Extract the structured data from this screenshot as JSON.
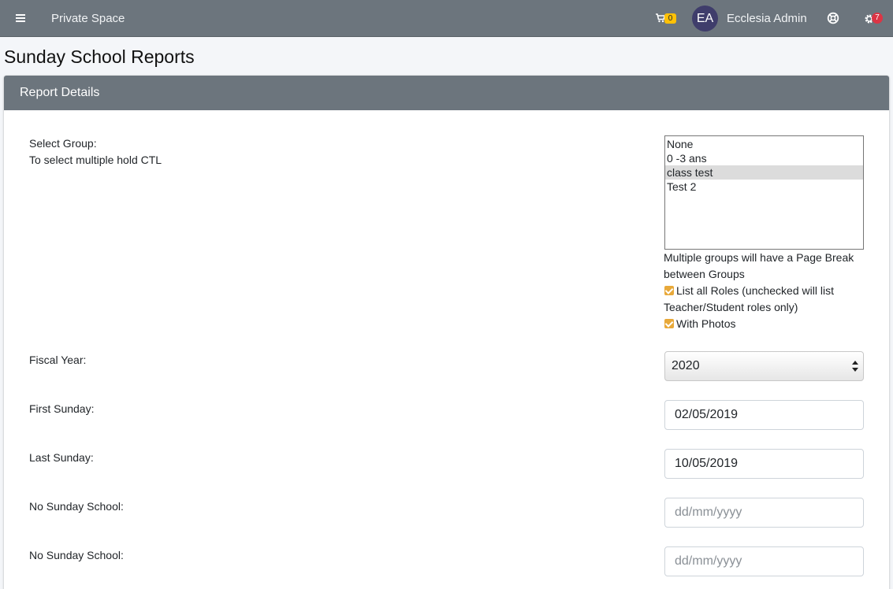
{
  "navbar": {
    "brand": "Private Space",
    "cart_count": "0",
    "avatar_initials": "EA",
    "user_name": "Ecclesia Admin",
    "notifications_count": "7",
    "colors": {
      "bar": "#6c757d",
      "cart_badge": "#ffc107",
      "notify_badge": "#dc3545",
      "avatar": "#3f3d6b"
    }
  },
  "page": {
    "title": "Sunday School Reports"
  },
  "card": {
    "title": "Report Details",
    "select_group": {
      "label_line1": "Select Group:",
      "label_line2": "To select multiple hold CTL",
      "options": [
        "None",
        "0 -3 ans",
        "class test",
        "Test 2"
      ],
      "selected": "class test"
    },
    "page_break_note": "Multiple groups will have a Page Break between Groups",
    "list_all_roles": {
      "label": "List all Roles (unchecked will list Teacher/Student roles only)",
      "checked": true
    },
    "with_photos": {
      "label": "With Photos",
      "checked": true
    },
    "fiscal_year": {
      "label": "Fiscal Year:",
      "value": "2020"
    },
    "first_sunday": {
      "label": "First Sunday:",
      "value": "02/05/2019"
    },
    "last_sunday": {
      "label": "Last Sunday:",
      "value": "10/05/2019"
    },
    "no_sunday_school_1": {
      "label": "No Sunday School:",
      "placeholder": "dd/mm/yyyy"
    },
    "no_sunday_school_2": {
      "label": "No Sunday School:",
      "placeholder": "dd/mm/yyyy"
    }
  }
}
